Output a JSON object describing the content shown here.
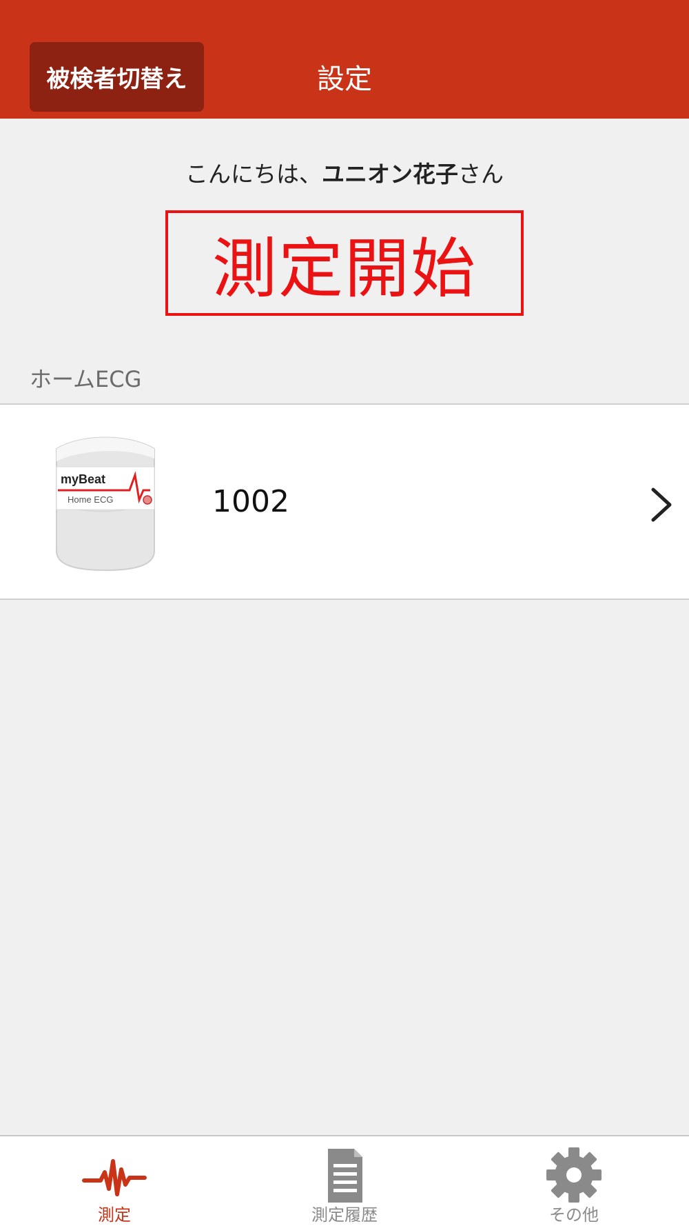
{
  "header": {
    "switch_button": "被検者切替え",
    "title": "設定"
  },
  "greeting": {
    "prefix": "こんにちは、",
    "name": "ユニオン花子",
    "suffix": "さん"
  },
  "start_button": "測定開始",
  "section": {
    "label": "ホームECG"
  },
  "device": {
    "name": "1002",
    "logo_text_top": "myBeat",
    "logo_text_bottom": "Home ECG",
    "icon": "chevron-right-icon"
  },
  "tabs": [
    {
      "label": "測定",
      "icon": "heartbeat-icon",
      "active": true
    },
    {
      "label": "測定履歴",
      "icon": "document-icon",
      "active": false
    },
    {
      "label": "その他",
      "icon": "gear-icon",
      "active": false
    }
  ],
  "colors": {
    "header_bg": "#c93318",
    "switch_button_bg": "#8e2212",
    "start_accent": "#ea1212",
    "background": "#f0f0f0",
    "tab_active": "#c93318",
    "tab_inactive": "#8a8a8a"
  }
}
